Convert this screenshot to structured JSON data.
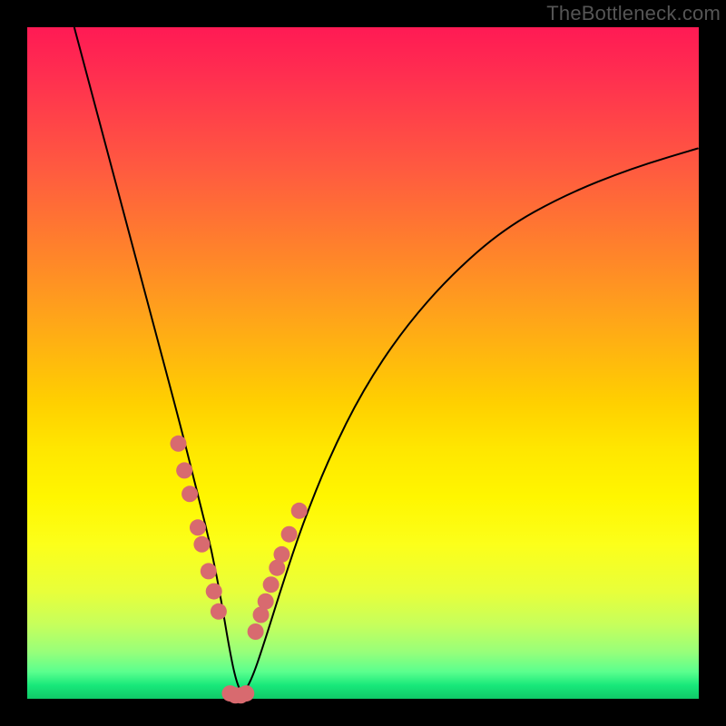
{
  "watermark": "TheBottleneck.com",
  "chart_data": {
    "type": "line",
    "title": "",
    "xlabel": "",
    "ylabel": "",
    "xlim": [
      0,
      100
    ],
    "ylim": [
      0,
      100
    ],
    "grid": false,
    "series": [
      {
        "name": "bottleneck-curve",
        "x": [
          7,
          11,
          15,
          19,
          23,
          25.5,
          27.5,
          29,
          30,
          31,
          32,
          33.5,
          35.5,
          38,
          41,
          45,
          50,
          56,
          63,
          71,
          80,
          90,
          100
        ],
        "y": [
          100,
          85,
          70,
          55,
          40,
          30,
          22,
          14,
          8,
          3,
          0.5,
          3,
          9,
          17,
          26,
          36,
          46,
          55,
          63,
          70,
          75,
          79,
          82
        ]
      }
    ],
    "annotations": {
      "dots_left_cluster": [
        {
          "x": 22.5,
          "y": 38
        },
        {
          "x": 23.4,
          "y": 34
        },
        {
          "x": 24.2,
          "y": 30.5
        },
        {
          "x": 25.4,
          "y": 25.5
        },
        {
          "x": 26.0,
          "y": 23
        },
        {
          "x": 27.0,
          "y": 19
        },
        {
          "x": 27.8,
          "y": 16
        },
        {
          "x": 28.5,
          "y": 13
        }
      ],
      "dots_right_cluster": [
        {
          "x": 34.0,
          "y": 10
        },
        {
          "x": 34.8,
          "y": 12.5
        },
        {
          "x": 35.5,
          "y": 14.5
        },
        {
          "x": 36.3,
          "y": 17
        },
        {
          "x": 37.2,
          "y": 19.5
        },
        {
          "x": 37.9,
          "y": 21.5
        },
        {
          "x": 39.0,
          "y": 24.5
        },
        {
          "x": 40.5,
          "y": 28
        }
      ],
      "dots_bottom_cluster": [
        {
          "x": 30.2,
          "y": 0.8
        },
        {
          "x": 31.0,
          "y": 0.5
        },
        {
          "x": 31.8,
          "y": 0.5
        },
        {
          "x": 32.6,
          "y": 0.8
        }
      ]
    },
    "background_gradient": {
      "type": "vertical",
      "stops": [
        {
          "pos": 0.0,
          "color": "#ff1a54"
        },
        {
          "pos": 0.5,
          "color": "#ffd000"
        },
        {
          "pos": 0.8,
          "color": "#f0ff30"
        },
        {
          "pos": 0.96,
          "color": "#5aff8e"
        },
        {
          "pos": 1.0,
          "color": "#10c868"
        }
      ]
    }
  }
}
